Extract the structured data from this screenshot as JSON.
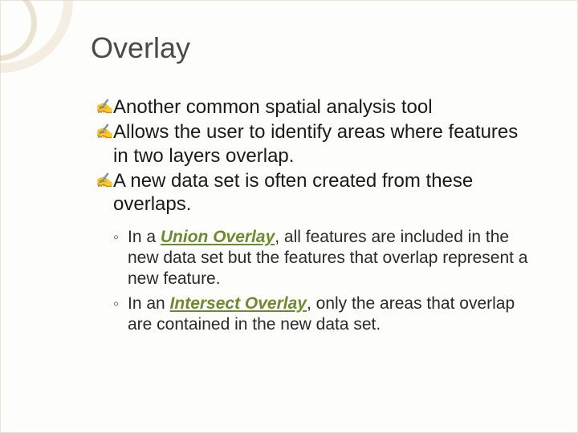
{
  "title": "Overlay",
  "bullets": [
    {
      "text": "Another common spatial analysis tool"
    },
    {
      "text": "Allows the user to identify areas where features in two layers overlap."
    },
    {
      "text": "A new data set is often created from these overlaps."
    }
  ],
  "sub": [
    {
      "pre": "In a ",
      "keyword": "Union Overlay",
      "post": ", all features are included in the new data set but the features that overlap represent a new feature."
    },
    {
      "pre": "In an ",
      "keyword": "Intersect Overlay",
      "post": ", only the areas that overlap are contained in the new data set."
    }
  ],
  "glyphs": {
    "main": "✍",
    "sub": "◦"
  }
}
